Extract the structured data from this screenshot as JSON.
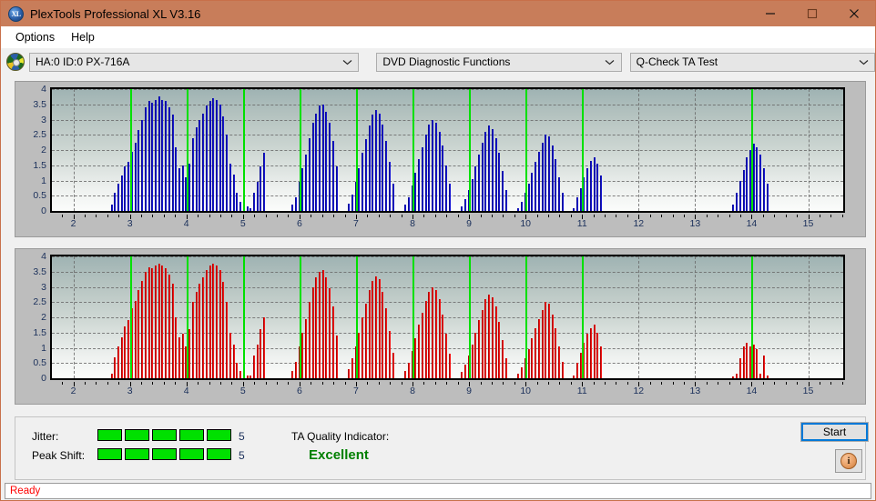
{
  "window": {
    "title": "PlexTools Professional XL V3.16",
    "app_icon": "XL",
    "controls": {
      "minimize": "minimize-icon",
      "maximize": "maximize-icon",
      "close": "close-icon"
    }
  },
  "menu": {
    "items": [
      "Options",
      "Help"
    ]
  },
  "toolbar": {
    "drive": {
      "value": "HA:0 ID:0  PX-716A",
      "icon": "disc-icon"
    },
    "function": {
      "value": "DVD Diagnostic Functions"
    },
    "test": {
      "value": "Q-Check TA Test"
    }
  },
  "info_panel": {
    "jitter_label": "Jitter:",
    "jitter_value": "5",
    "jitter_segments": 5,
    "peak_shift_label": "Peak Shift:",
    "peak_shift_value": "5",
    "peak_shift_segments": 5,
    "segments_total": 5,
    "ta_quality_label": "TA Quality Indicator:",
    "ta_quality_value": "Excellent",
    "ta_quality_color": "#008000",
    "start_button": "Start",
    "info_button": "i"
  },
  "status": {
    "text": "Ready",
    "color": "#ff0000"
  },
  "chart_data": [
    {
      "id": "top",
      "type": "bar",
      "title": "",
      "xlabel": "",
      "ylabel": "",
      "series_name": "Jitter",
      "color": "#1414d2",
      "xlim": [
        1.62,
        15.62
      ],
      "ylim": [
        0,
        4
      ],
      "yticks": [
        0,
        0.5,
        1,
        1.5,
        2,
        2.5,
        3,
        3.5,
        4
      ],
      "ytick_labels": [
        "0",
        "0.5",
        "1",
        "1.5",
        "2",
        "2.5",
        "3",
        "3.5",
        "4"
      ],
      "xticks": [
        2,
        3,
        4,
        5,
        6,
        7,
        8,
        9,
        10,
        11,
        12,
        13,
        14,
        15
      ],
      "xtick_labels": [
        "2",
        "3",
        "4",
        "5",
        "6",
        "7",
        "8",
        "9",
        "10",
        "11",
        "12",
        "13",
        "14",
        "15"
      ],
      "grid": true,
      "markers": [
        3,
        4,
        5,
        6,
        7,
        8,
        9,
        10,
        11,
        14
      ],
      "marker_color": "#00e000",
      "x": [
        2.66,
        2.72,
        2.78,
        2.84,
        2.9,
        2.96,
        3.02,
        3.08,
        3.14,
        3.2,
        3.26,
        3.32,
        3.38,
        3.44,
        3.5,
        3.56,
        3.62,
        3.68,
        3.74,
        3.8,
        3.86,
        3.92,
        3.98,
        4.04,
        4.1,
        4.16,
        4.22,
        4.28,
        4.34,
        4.4,
        4.46,
        4.52,
        4.58,
        4.64,
        4.7,
        4.76,
        4.82,
        4.88,
        4.94,
        5.0,
        5.06,
        5.12,
        5.18,
        5.24,
        5.3,
        5.36,
        5.86,
        5.92,
        5.98,
        6.04,
        6.1,
        6.16,
        6.22,
        6.28,
        6.34,
        6.4,
        6.46,
        6.52,
        6.58,
        6.64,
        6.86,
        6.92,
        6.98,
        7.04,
        7.1,
        7.16,
        7.22,
        7.28,
        7.34,
        7.4,
        7.46,
        7.52,
        7.58,
        7.64,
        7.86,
        7.92,
        7.98,
        8.04,
        8.1,
        8.16,
        8.22,
        8.28,
        8.34,
        8.4,
        8.46,
        8.52,
        8.58,
        8.64,
        8.86,
        8.92,
        8.98,
        9.04,
        9.1,
        9.16,
        9.22,
        9.28,
        9.34,
        9.4,
        9.46,
        9.52,
        9.58,
        9.64,
        9.86,
        9.92,
        9.98,
        10.04,
        10.1,
        10.16,
        10.22,
        10.28,
        10.34,
        10.4,
        10.46,
        10.52,
        10.58,
        10.64,
        10.84,
        10.9,
        10.96,
        11.02,
        11.08,
        11.14,
        11.2,
        11.26,
        11.32,
        13.66,
        13.72,
        13.78,
        13.84,
        13.9,
        13.96,
        14.02,
        14.08,
        14.14,
        14.2,
        14.26
      ],
      "values": [
        0.2,
        0.6,
        0.9,
        1.15,
        1.45,
        1.6,
        1.95,
        2.25,
        2.65,
        3.0,
        3.4,
        3.6,
        3.55,
        3.65,
        3.75,
        3.65,
        3.6,
        3.4,
        3.15,
        2.1,
        1.4,
        1.5,
        1.1,
        1.55,
        2.4,
        2.75,
        3.0,
        3.2,
        3.45,
        3.6,
        3.7,
        3.65,
        3.5,
        3.1,
        2.5,
        1.55,
        1.2,
        0.6,
        0.3,
        0.2,
        0.15,
        0.1,
        0.6,
        0.95,
        1.45,
        1.9,
        0.2,
        0.45,
        0.95,
        1.4,
        1.85,
        2.4,
        2.9,
        3.2,
        3.45,
        3.5,
        3.25,
        2.9,
        2.3,
        1.45,
        0.25,
        0.55,
        0.95,
        1.4,
        1.9,
        2.35,
        2.8,
        3.15,
        3.3,
        3.2,
        2.85,
        2.3,
        1.6,
        0.9,
        0.2,
        0.45,
        0.85,
        1.25,
        1.7,
        2.1,
        2.5,
        2.85,
        3.0,
        2.9,
        2.6,
        2.15,
        1.5,
        0.9,
        0.15,
        0.4,
        0.7,
        1.05,
        1.45,
        1.85,
        2.25,
        2.6,
        2.8,
        2.7,
        2.4,
        1.9,
        1.3,
        0.7,
        0.1,
        0.3,
        0.6,
        0.9,
        1.25,
        1.6,
        1.95,
        2.25,
        2.5,
        2.45,
        2.15,
        1.7,
        1.1,
        0.6,
        0.1,
        0.45,
        0.75,
        1.1,
        1.4,
        1.65,
        1.75,
        1.55,
        1.15,
        0.2,
        0.6,
        1.0,
        1.35,
        1.75,
        2.0,
        2.2,
        2.1,
        1.85,
        1.4,
        0.9
      ]
    },
    {
      "id": "bottom",
      "type": "bar",
      "title": "",
      "xlabel": "",
      "ylabel": "",
      "series_name": "Peak Shift",
      "color": "#f41414",
      "xlim": [
        1.62,
        15.62
      ],
      "ylim": [
        0,
        4
      ],
      "yticks": [
        0,
        0.5,
        1,
        1.5,
        2,
        2.5,
        3,
        3.5,
        4
      ],
      "ytick_labels": [
        "0",
        "0.5",
        "1",
        "1.5",
        "2",
        "2.5",
        "3",
        "3.5",
        "4"
      ],
      "xticks": [
        2,
        3,
        4,
        5,
        6,
        7,
        8,
        9,
        10,
        11,
        12,
        13,
        14,
        15
      ],
      "xtick_labels": [
        "2",
        "3",
        "4",
        "5",
        "6",
        "7",
        "8",
        "9",
        "10",
        "11",
        "12",
        "13",
        "14",
        "15"
      ],
      "grid": true,
      "markers": [
        3,
        4,
        5,
        6,
        7,
        8,
        9,
        10,
        11,
        14
      ],
      "marker_color": "#00e000",
      "x": [
        2.66,
        2.72,
        2.78,
        2.84,
        2.9,
        2.96,
        3.02,
        3.08,
        3.14,
        3.2,
        3.26,
        3.32,
        3.38,
        3.44,
        3.5,
        3.56,
        3.62,
        3.68,
        3.74,
        3.8,
        3.86,
        3.92,
        3.98,
        4.04,
        4.1,
        4.16,
        4.22,
        4.28,
        4.34,
        4.4,
        4.46,
        4.52,
        4.58,
        4.64,
        4.7,
        4.76,
        4.82,
        4.88,
        4.94,
        5.0,
        5.06,
        5.12,
        5.18,
        5.24,
        5.3,
        5.36,
        5.86,
        5.92,
        5.98,
        6.04,
        6.1,
        6.16,
        6.22,
        6.28,
        6.34,
        6.4,
        6.46,
        6.52,
        6.58,
        6.64,
        6.86,
        6.92,
        6.98,
        7.04,
        7.1,
        7.16,
        7.22,
        7.28,
        7.34,
        7.4,
        7.46,
        7.52,
        7.58,
        7.64,
        7.86,
        7.92,
        7.98,
        8.04,
        8.1,
        8.16,
        8.22,
        8.28,
        8.34,
        8.4,
        8.46,
        8.52,
        8.58,
        8.64,
        8.86,
        8.92,
        8.98,
        9.04,
        9.1,
        9.16,
        9.22,
        9.28,
        9.34,
        9.4,
        9.46,
        9.52,
        9.58,
        9.64,
        9.86,
        9.92,
        9.98,
        10.04,
        10.1,
        10.16,
        10.22,
        10.28,
        10.34,
        10.4,
        10.46,
        10.52,
        10.58,
        10.64,
        10.84,
        10.9,
        10.96,
        11.02,
        11.08,
        11.14,
        11.2,
        11.26,
        11.32,
        13.66,
        13.72,
        13.78,
        13.84,
        13.9,
        13.96,
        14.02,
        14.08,
        14.14,
        14.2,
        14.26
      ],
      "values": [
        0.15,
        0.7,
        1.05,
        1.35,
        1.7,
        1.9,
        2.3,
        2.55,
        2.9,
        3.2,
        3.5,
        3.65,
        3.6,
        3.7,
        3.75,
        3.7,
        3.6,
        3.4,
        3.1,
        2.0,
        1.35,
        1.45,
        1.05,
        1.6,
        2.5,
        2.85,
        3.1,
        3.3,
        3.55,
        3.7,
        3.75,
        3.7,
        3.55,
        3.15,
        2.5,
        1.5,
        1.1,
        0.5,
        0.25,
        0.15,
        0.1,
        0.1,
        0.75,
        1.1,
        1.6,
        2.0,
        0.25,
        0.55,
        1.05,
        1.5,
        1.95,
        2.5,
        3.0,
        3.3,
        3.5,
        3.55,
        3.3,
        2.95,
        2.35,
        1.4,
        0.3,
        0.65,
        1.05,
        1.5,
        2.0,
        2.45,
        2.9,
        3.2,
        3.35,
        3.25,
        2.85,
        2.3,
        1.55,
        0.85,
        0.25,
        0.5,
        0.9,
        1.3,
        1.75,
        2.15,
        2.55,
        2.85,
        3.0,
        2.9,
        2.6,
        2.1,
        1.45,
        0.8,
        0.2,
        0.45,
        0.75,
        1.1,
        1.5,
        1.9,
        2.25,
        2.6,
        2.75,
        2.65,
        2.35,
        1.85,
        1.25,
        0.65,
        0.15,
        0.35,
        0.65,
        0.95,
        1.3,
        1.65,
        1.95,
        2.25,
        2.5,
        2.45,
        2.1,
        1.65,
        1.05,
        0.55,
        0.1,
        0.5,
        0.85,
        1.15,
        1.45,
        1.65,
        1.75,
        1.5,
        1.05,
        0.05,
        0.15,
        0.65,
        1.05,
        1.15,
        1.05,
        1.1,
        0.95,
        0.15,
        0.75,
        0.1
      ]
    }
  ]
}
